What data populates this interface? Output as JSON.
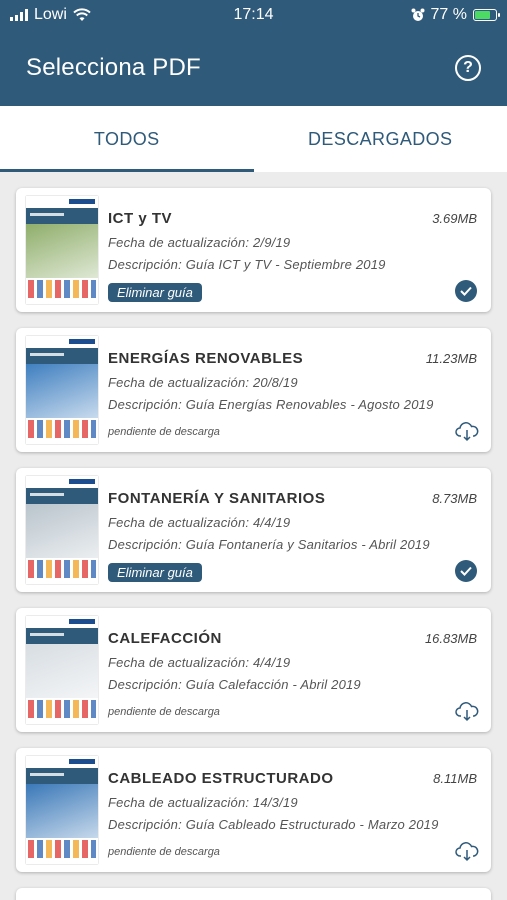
{
  "status_bar": {
    "carrier": "Lowi",
    "time": "17:14",
    "battery": "77 %"
  },
  "header": {
    "title": "Selecciona PDF",
    "help_icon": "question-circle-icon"
  },
  "tabs": [
    {
      "label": "TODOS",
      "active": true
    },
    {
      "label": "DESCARGADOS",
      "active": false
    }
  ],
  "guides": [
    {
      "title": "ICT y TV",
      "size": "3.69MB",
      "updated": "Fecha de actualización: 2/9/19",
      "description": "Descripción: Guía ICT y TV - Septiembre 2019",
      "downloaded": true,
      "action": "Eliminar guía",
      "cover_color": "#8fae6b"
    },
    {
      "title": "ENERGÍAS RENOVABLES",
      "size": "11.23MB",
      "updated": "Fecha de actualización: 20/8/19",
      "description": "Descripción: Guía Energías Renovables - Agosto 2019",
      "downloaded": false,
      "action": "pendiente de descarga",
      "cover_color": "#3f7fc0"
    },
    {
      "title": "FONTANERÍA Y SANITARIOS",
      "size": "8.73MB",
      "updated": "Fecha de actualización: 4/4/19",
      "description": "Descripción: Guía Fontanería y Sanitarios - Abril 2019",
      "downloaded": true,
      "action": "Eliminar guía",
      "cover_color": "#b9c4cc"
    },
    {
      "title": "CALEFACCIÓN",
      "size": "16.83MB",
      "updated": "Fecha de actualización: 4/4/19",
      "description": "Descripción: Guía Calefacción - Abril 2019",
      "downloaded": false,
      "action": "pendiente de descarga",
      "cover_color": "#d7dde2"
    },
    {
      "title": "CABLEADO ESTRUCTURADO",
      "size": "8.11MB",
      "updated": "Fecha de actualización: 14/3/19",
      "description": "Descripción: Guía Cableado Estructurado - Marzo 2019",
      "downloaded": false,
      "action": "pendiente de descarga",
      "cover_color": "#3a78b8"
    }
  ],
  "colors": {
    "primary": "#2f5a7a",
    "background": "#ececec"
  }
}
